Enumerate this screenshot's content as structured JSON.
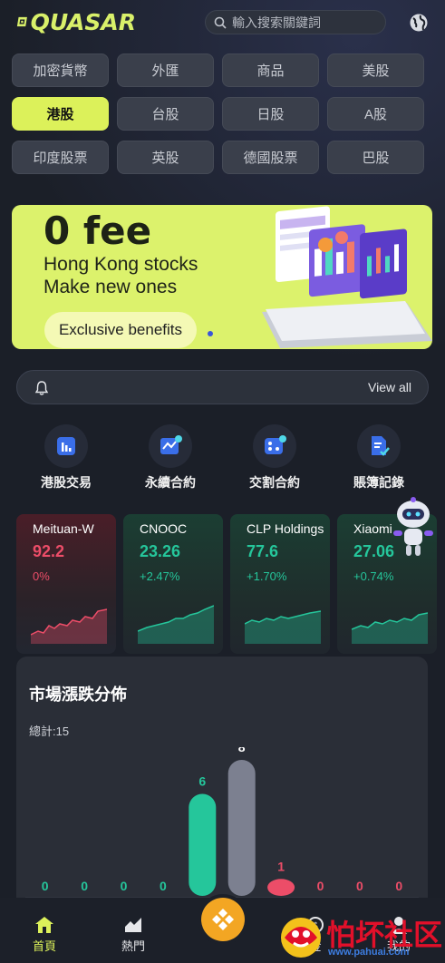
{
  "header": {
    "logo_text": "QUASAR",
    "search_placeholder": "輸入搜索關鍵詞",
    "globe_icon": "globe-icon"
  },
  "categories": [
    {
      "label": "加密貨幣",
      "active": false
    },
    {
      "label": "外匯",
      "active": false
    },
    {
      "label": "商品",
      "active": false
    },
    {
      "label": "美股",
      "active": false
    },
    {
      "label": "港股",
      "active": true
    },
    {
      "label": "台股",
      "active": false
    },
    {
      "label": "日股",
      "active": false
    },
    {
      "label": "A股",
      "active": false
    },
    {
      "label": "印度股票",
      "active": false
    },
    {
      "label": "英股",
      "active": false
    },
    {
      "label": "德國股票",
      "active": false
    },
    {
      "label": "巴股",
      "active": false
    }
  ],
  "banner": {
    "title": "0 fee",
    "line1": "Hong Kong stocks",
    "line2": "Make new ones",
    "button": "Exclusive benefits"
  },
  "notice": {
    "view_all": "View all",
    "icon": "bell-icon"
  },
  "quick_actions": [
    {
      "label": "港股交易",
      "icon": "chart-bar-icon"
    },
    {
      "label": "永續合約",
      "icon": "contract-chart-icon"
    },
    {
      "label": "交割合約",
      "icon": "dice-icon"
    },
    {
      "label": "賬簿記錄",
      "icon": "ledger-check-icon"
    }
  ],
  "stocks": [
    {
      "name": "Meituan-W",
      "price": "92.2",
      "change": "0%",
      "trend": "down"
    },
    {
      "name": "CNOOC",
      "price": "23.26",
      "change": "+2.47%",
      "trend": "up"
    },
    {
      "name": "CLP Holdings",
      "price": "77.6",
      "change": "+1.70%",
      "trend": "up"
    },
    {
      "name": "Xiaomi",
      "price": "27.06",
      "change": "+0.74%",
      "trend": "up"
    }
  ],
  "distribution": {
    "title": "市場漲跌分佈",
    "total": "總計:15"
  },
  "chart_data": {
    "type": "bar",
    "title": "市場漲跌分佈",
    "categories": [
      "",
      "",
      "",
      "",
      "",
      "",
      "",
      "",
      "",
      ""
    ],
    "values": [
      0,
      0,
      0,
      0,
      6,
      8,
      1,
      0,
      0,
      0
    ],
    "colors": [
      "#25c69b",
      "#25c69b",
      "#25c69b",
      "#25c69b",
      "#25c69b",
      "#7c8090",
      "#ec4d68",
      "#ec4d68",
      "#ec4d68",
      "#ec4d68"
    ],
    "ylim": [
      0,
      8
    ]
  },
  "nav": {
    "items": [
      {
        "label": "首頁",
        "icon": "home-icon",
        "active": true
      },
      {
        "label": "熱門",
        "icon": "trend-icon",
        "active": false
      },
      {
        "label": "金",
        "icon": "coin-icon",
        "active": false
      },
      {
        "label": "我的",
        "icon": "user-icon",
        "active": false
      }
    ],
    "center_icon": "trade-center-icon"
  },
  "watermark": {
    "title": "怕坏社区",
    "url": "www.pahuai.com"
  },
  "colors": {
    "accent": "#dcf15a",
    "up": "#25c69b",
    "down": "#ec4d68"
  }
}
